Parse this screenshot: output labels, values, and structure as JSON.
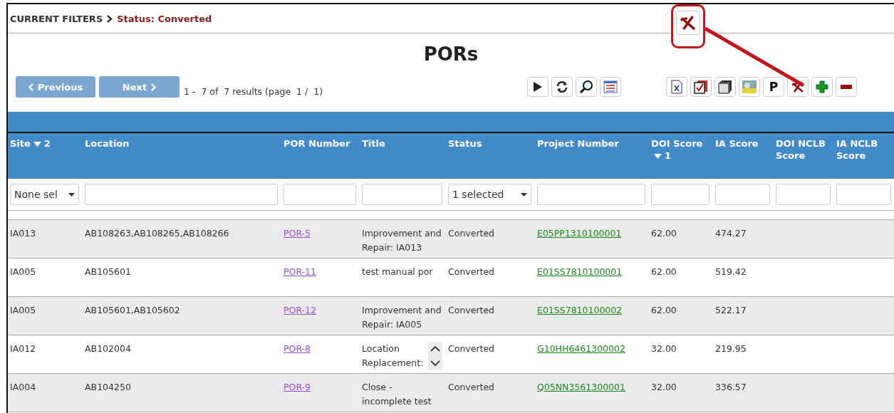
{
  "filters": {
    "label": "CURRENT FILTERS",
    "value": "Status: Converted"
  },
  "callout": {
    "kind": "clear"
  },
  "title": "PORs",
  "pagination": {
    "previous": "Previous",
    "next": "Next",
    "summary": "1 -  7 of  7 results (page  1 /  1)"
  },
  "toolbar_left": [
    {
      "kind": "play"
    },
    {
      "kind": "refresh"
    },
    {
      "kind": "search"
    },
    {
      "kind": "table"
    }
  ],
  "toolbar_right": [
    {
      "kind": "excel"
    },
    {
      "kind": "checklist"
    },
    {
      "kind": "pages"
    },
    {
      "kind": "image"
    },
    {
      "kind": "letter",
      "label": "P"
    },
    {
      "kind": "clear"
    },
    {
      "kind": "add"
    },
    {
      "kind": "remove"
    }
  ],
  "columns": [
    {
      "label": "Site",
      "sort_order": "2",
      "kind": "text",
      "filter": {
        "kind": "select",
        "value": "None sel"
      }
    },
    {
      "label": "Location",
      "kind": "text",
      "filter": {
        "kind": "input"
      }
    },
    {
      "label": "POR Number",
      "kind": "link",
      "filter": {
        "kind": "input"
      }
    },
    {
      "label": "Title",
      "kind": "text",
      "filter": {
        "kind": "input"
      }
    },
    {
      "label": "Status",
      "kind": "text",
      "filter": {
        "kind": "select",
        "value": "1 selected"
      }
    },
    {
      "label": "Project Number",
      "kind": "project-link",
      "filter": {
        "kind": "input"
      }
    },
    {
      "label": "DOI Score",
      "sort_order": "1",
      "kind": "text",
      "filter": {
        "kind": "input"
      }
    },
    {
      "label": "IA Score",
      "kind": "text",
      "filter": {
        "kind": "input"
      }
    },
    {
      "label": "DOI NCLB Score",
      "filter": {
        "kind": "input"
      }
    },
    {
      "label": "IA NCLB Score",
      "filter": {
        "kind": "input"
      }
    }
  ],
  "rows": [
    {
      "cells": [
        "IA013",
        "AB108263,AB108265,AB108266",
        "POR-5",
        "Improvement and Repair: IA013",
        "Converted",
        "E05PP1310100001",
        "62.00",
        "474.27"
      ],
      "scroll_control": false
    },
    {
      "cells": [
        "IA005",
        "AB105601",
        "POR-11",
        "test manual por",
        "Converted",
        "E01SS7810100001",
        "62.00",
        "519.42"
      ],
      "scroll_control": false
    },
    {
      "cells": [
        "IA005",
        "AB105601,AB105602",
        "POR-12",
        "Improvement and Repair: IA005",
        "Converted",
        "E01SS7810100002",
        "62.00",
        "522.17"
      ],
      "scroll_control": false
    },
    {
      "cells": [
        "IA012",
        "AB102004",
        "POR-8",
        "Location Replacement:",
        "Converted",
        "G10HH6461300002",
        "32.00",
        "219.95"
      ],
      "scroll_control": true
    },
    {
      "cells": [
        "IA004",
        "AB104250",
        "POR-9",
        "Close - incomplete test",
        "Converted",
        "Q05NN3561300001",
        "32.00",
        "336.57"
      ],
      "scroll_control": false
    }
  ]
}
